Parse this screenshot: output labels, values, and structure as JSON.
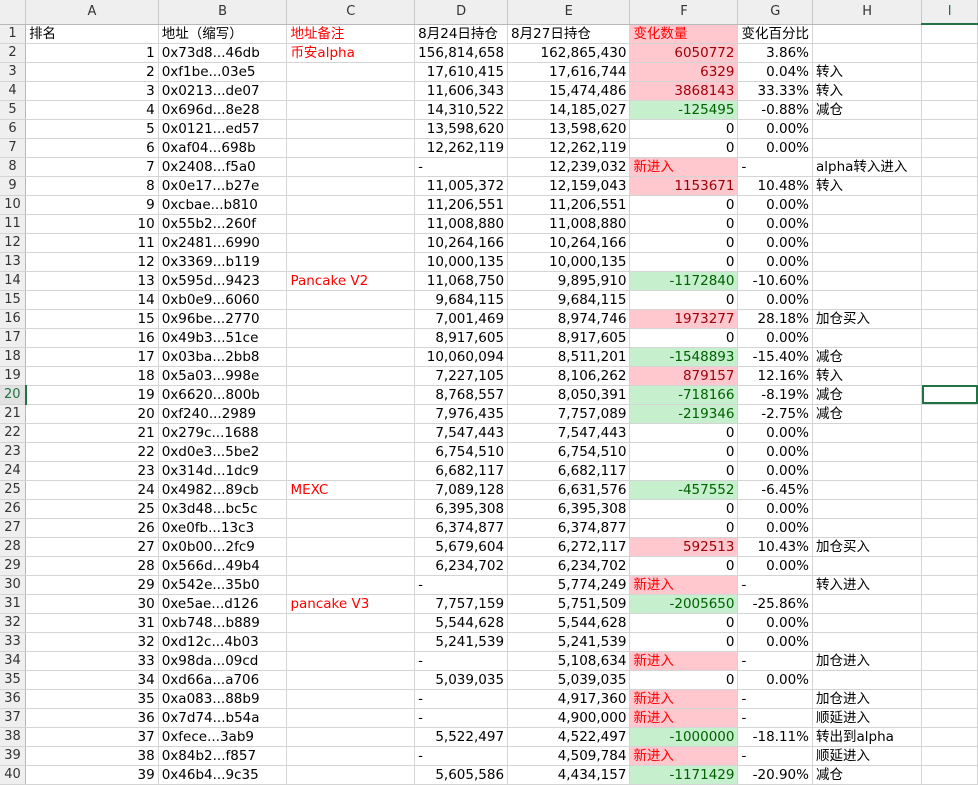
{
  "sheet": {
    "columns": [
      "A",
      "B",
      "C",
      "D",
      "E",
      "F",
      "G",
      "H",
      "I"
    ],
    "header_row": {
      "rownum": "1",
      "A": "排名",
      "B": "地址（缩写）",
      "C": "地址备注",
      "D": "8月24日持仓",
      "E": "8月27日持仓",
      "F": "变化数量",
      "G": "变化百分比",
      "H": "",
      "I": ""
    },
    "rows": [
      {
        "r": "2",
        "rank": "1",
        "addr": "0x73d8...46db",
        "note": "币安alpha",
        "d24": "156,814,658",
        "d27": "162,865,430",
        "chg": "6050772",
        "pct": "3.86%",
        "remark": ""
      },
      {
        "r": "3",
        "rank": "2",
        "addr": "0xf1be...03e5",
        "note": "",
        "d24": "17,610,415",
        "d27": "17,616,744",
        "chg": "6329",
        "pct": "0.04%",
        "remark": "转入"
      },
      {
        "r": "4",
        "rank": "3",
        "addr": "0x0213...de07",
        "note": "",
        "d24": "11,606,343",
        "d27": "15,474,486",
        "chg": "3868143",
        "pct": "33.33%",
        "remark": "转入"
      },
      {
        "r": "5",
        "rank": "4",
        "addr": "0x696d...8e28",
        "note": "",
        "d24": "14,310,522",
        "d27": "14,185,027",
        "chg": "-125495",
        "pct": "-0.88%",
        "remark": "减仓"
      },
      {
        "r": "6",
        "rank": "5",
        "addr": "0x0121...ed57",
        "note": "",
        "d24": "13,598,620",
        "d27": "13,598,620",
        "chg": "0",
        "pct": "0.00%",
        "remark": ""
      },
      {
        "r": "7",
        "rank": "6",
        "addr": "0xaf04...698b",
        "note": "",
        "d24": "12,262,119",
        "d27": "12,262,119",
        "chg": "0",
        "pct": "0.00%",
        "remark": ""
      },
      {
        "r": "8",
        "rank": "7",
        "addr": "0x2408...f5a0",
        "note": "",
        "d24": "-",
        "d27": "12,239,032",
        "chg": "新进入",
        "pct": "-",
        "remark": "alpha转入进入"
      },
      {
        "r": "9",
        "rank": "8",
        "addr": "0x0e17...b27e",
        "note": "",
        "d24": "11,005,372",
        "d27": "12,159,043",
        "chg": "1153671",
        "pct": "10.48%",
        "remark": "转入"
      },
      {
        "r": "10",
        "rank": "9",
        "addr": "0xcbae...b810",
        "note": "",
        "d24": "11,206,551",
        "d27": "11,206,551",
        "chg": "0",
        "pct": "0.00%",
        "remark": ""
      },
      {
        "r": "11",
        "rank": "10",
        "addr": "0x55b2...260f",
        "note": "",
        "d24": "11,008,880",
        "d27": "11,008,880",
        "chg": "0",
        "pct": "0.00%",
        "remark": ""
      },
      {
        "r": "12",
        "rank": "11",
        "addr": "0x2481...6990",
        "note": "",
        "d24": "10,264,166",
        "d27": "10,264,166",
        "chg": "0",
        "pct": "0.00%",
        "remark": ""
      },
      {
        "r": "13",
        "rank": "12",
        "addr": "0x3369...b119",
        "note": "",
        "d24": "10,000,135",
        "d27": "10,000,135",
        "chg": "0",
        "pct": "0.00%",
        "remark": ""
      },
      {
        "r": "14",
        "rank": "13",
        "addr": "0x595d...9423",
        "note": "Pancake V2",
        "d24": "11,068,750",
        "d27": "9,895,910",
        "chg": "-1172840",
        "pct": "-10.60%",
        "remark": ""
      },
      {
        "r": "15",
        "rank": "14",
        "addr": "0xb0e9...6060",
        "note": "",
        "d24": "9,684,115",
        "d27": "9,684,115",
        "chg": "0",
        "pct": "0.00%",
        "remark": ""
      },
      {
        "r": "16",
        "rank": "15",
        "addr": "0x96be...2770",
        "note": "",
        "d24": "7,001,469",
        "d27": "8,974,746",
        "chg": "1973277",
        "pct": "28.18%",
        "remark": "加仓买入"
      },
      {
        "r": "17",
        "rank": "16",
        "addr": "0x49b3...51ce",
        "note": "",
        "d24": "8,917,605",
        "d27": "8,917,605",
        "chg": "0",
        "pct": "0.00%",
        "remark": ""
      },
      {
        "r": "18",
        "rank": "17",
        "addr": "0x03ba...2bb8",
        "note": "",
        "d24": "10,060,094",
        "d27": "8,511,201",
        "chg": "-1548893",
        "pct": "-15.40%",
        "remark": "减仓"
      },
      {
        "r": "19",
        "rank": "18",
        "addr": "0x5a03...998e",
        "note": "",
        "d24": "7,227,105",
        "d27": "8,106,262",
        "chg": "879157",
        "pct": "12.16%",
        "remark": "转入"
      },
      {
        "r": "20",
        "rank": "19",
        "addr": "0x6620...800b",
        "note": "",
        "d24": "8,768,557",
        "d27": "8,050,391",
        "chg": "-718166",
        "pct": "-8.19%",
        "remark": "减仓"
      },
      {
        "r": "21",
        "rank": "20",
        "addr": "0xf240...2989",
        "note": "",
        "d24": "7,976,435",
        "d27": "7,757,089",
        "chg": "-219346",
        "pct": "-2.75%",
        "remark": "减仓"
      },
      {
        "r": "22",
        "rank": "21",
        "addr": "0x279c...1688",
        "note": "",
        "d24": "7,547,443",
        "d27": "7,547,443",
        "chg": "0",
        "pct": "0.00%",
        "remark": ""
      },
      {
        "r": "23",
        "rank": "22",
        "addr": "0xd0e3...5be2",
        "note": "",
        "d24": "6,754,510",
        "d27": "6,754,510",
        "chg": "0",
        "pct": "0.00%",
        "remark": ""
      },
      {
        "r": "24",
        "rank": "23",
        "addr": "0x314d...1dc9",
        "note": "",
        "d24": "6,682,117",
        "d27": "6,682,117",
        "chg": "0",
        "pct": "0.00%",
        "remark": ""
      },
      {
        "r": "25",
        "rank": "24",
        "addr": "0x4982...89cb",
        "note": "MEXC",
        "d24": "7,089,128",
        "d27": "6,631,576",
        "chg": "-457552",
        "pct": "-6.45%",
        "remark": ""
      },
      {
        "r": "26",
        "rank": "25",
        "addr": "0x3d48...bc5c",
        "note": "",
        "d24": "6,395,308",
        "d27": "6,395,308",
        "chg": "0",
        "pct": "0.00%",
        "remark": ""
      },
      {
        "r": "27",
        "rank": "26",
        "addr": "0xe0fb...13c3",
        "note": "",
        "d24": "6,374,877",
        "d27": "6,374,877",
        "chg": "0",
        "pct": "0.00%",
        "remark": ""
      },
      {
        "r": "28",
        "rank": "27",
        "addr": "0x0b00...2fc9",
        "note": "",
        "d24": "5,679,604",
        "d27": "6,272,117",
        "chg": "592513",
        "pct": "10.43%",
        "remark": "加仓买入"
      },
      {
        "r": "29",
        "rank": "28",
        "addr": "0x566d...49b4",
        "note": "",
        "d24": "6,234,702",
        "d27": "6,234,702",
        "chg": "0",
        "pct": "0.00%",
        "remark": ""
      },
      {
        "r": "30",
        "rank": "29",
        "addr": "0x542e...35b0",
        "note": "",
        "d24": "-",
        "d27": "5,774,249",
        "chg": "新进入",
        "pct": "-",
        "remark": "转入进入"
      },
      {
        "r": "31",
        "rank": "30",
        "addr": "0xe5ae...d126",
        "note": "pancake V3",
        "d24": "7,757,159",
        "d27": "5,751,509",
        "chg": "-2005650",
        "pct": "-25.86%",
        "remark": ""
      },
      {
        "r": "32",
        "rank": "31",
        "addr": "0xb748...b889",
        "note": "",
        "d24": "5,544,628",
        "d27": "5,544,628",
        "chg": "0",
        "pct": "0.00%",
        "remark": ""
      },
      {
        "r": "33",
        "rank": "32",
        "addr": "0xd12c...4b03",
        "note": "",
        "d24": "5,241,539",
        "d27": "5,241,539",
        "chg": "0",
        "pct": "0.00%",
        "remark": ""
      },
      {
        "r": "34",
        "rank": "33",
        "addr": "0x98da...09cd",
        "note": "",
        "d24": "-",
        "d27": "5,108,634",
        "chg": "新进入",
        "pct": "-",
        "remark": "加仓进入"
      },
      {
        "r": "35",
        "rank": "34",
        "addr": "0xd66a...a706",
        "note": "",
        "d24": "5,039,035",
        "d27": "5,039,035",
        "chg": "0",
        "pct": "0.00%",
        "remark": ""
      },
      {
        "r": "36",
        "rank": "35",
        "addr": "0xa083...88b9",
        "note": "",
        "d24": "-",
        "d27": "4,917,360",
        "chg": "新进入",
        "pct": "-",
        "remark": "加仓进入"
      },
      {
        "r": "37",
        "rank": "36",
        "addr": "0x7d74...b54a",
        "note": "",
        "d24": "-",
        "d27": "4,900,000",
        "chg": "新进入",
        "pct": "-",
        "remark": "顺延进入"
      },
      {
        "r": "38",
        "rank": "37",
        "addr": "0xfece...3ab9",
        "note": "",
        "d24": "5,522,497",
        "d27": "4,522,497",
        "chg": "-1000000",
        "pct": "-18.11%",
        "remark": "转出到alpha"
      },
      {
        "r": "39",
        "rank": "38",
        "addr": "0x84b2...f857",
        "note": "",
        "d24": "-",
        "d27": "4,509,784",
        "chg": "新进入",
        "pct": "-",
        "remark": "顺延进入"
      },
      {
        "r": "40",
        "rank": "39",
        "addr": "0x46b4...9c35",
        "note": "",
        "d24": "5,605,586",
        "d27": "4,434,157",
        "chg": "-1171429",
        "pct": "-20.90%",
        "remark": "减仓"
      }
    ],
    "selected_cell": "I20",
    "colors": {
      "grid": "#d4d4d4",
      "header_bg": "#efefef",
      "select": "#217346",
      "pink_fill": "#ffc7ce",
      "green_fill": "#c6efce",
      "red_text": "#ff0000"
    }
  }
}
